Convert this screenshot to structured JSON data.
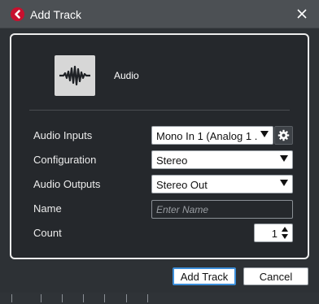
{
  "window": {
    "title": "Add Track",
    "app_icon": "cubase-logo-icon",
    "close_icon": "close-icon"
  },
  "track_type": {
    "icon": "audio-waveform-icon",
    "label": "Audio"
  },
  "form": {
    "audio_inputs": {
      "label": "Audio Inputs",
      "value": "Mono In 1 (Analog 1 ."
    },
    "configuration": {
      "label": "Configuration",
      "value": "Stereo"
    },
    "audio_outputs": {
      "label": "Audio Outputs",
      "value": "Stereo Out"
    },
    "name": {
      "label": "Name",
      "placeholder": "Enter Name",
      "value": ""
    },
    "count": {
      "label": "Count",
      "value": "1"
    }
  },
  "buttons": {
    "add_track": "Add Track",
    "cancel": "Cancel"
  },
  "colors": {
    "background": "#2d3135",
    "titlebar": "#4c5054",
    "panel": "#25282c",
    "accent": "#3c8ed9",
    "logo": "#c8102e"
  }
}
